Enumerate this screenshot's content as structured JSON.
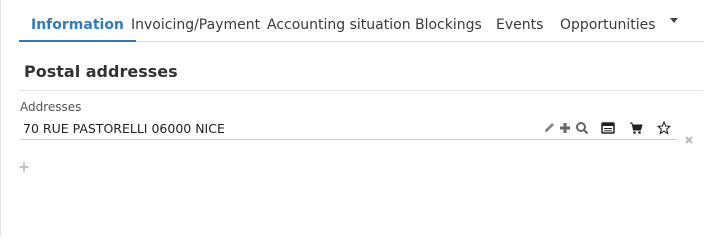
{
  "tabs": [
    {
      "label": "Information",
      "active": true
    },
    {
      "label": "Invoicing/Payment",
      "active": false
    },
    {
      "label": "Accounting situation",
      "active": false
    },
    {
      "label": "Blockings",
      "active": false
    },
    {
      "label": "Events",
      "active": false
    },
    {
      "label": "Opportunities",
      "active": false
    }
  ],
  "section": {
    "title": "Postal addresses"
  },
  "addresses": {
    "label": "Addresses",
    "value": "70 RUE PASTORELLI 06000 NICE",
    "icons": [
      "pencil-icon",
      "plus-icon",
      "search-icon",
      "card-icon",
      "cart-icon",
      "star-icon"
    ]
  },
  "colors": {
    "accent": "#2f7bbf",
    "text": "#333333",
    "icon": "#555555",
    "muted_icon": "#bbbbbb"
  }
}
